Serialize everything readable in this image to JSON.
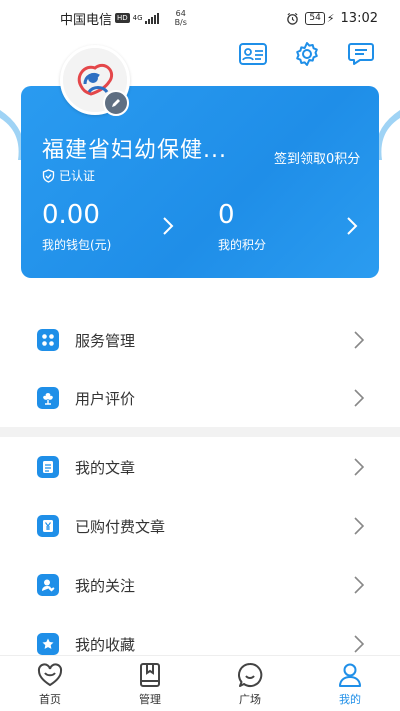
{
  "status_bar": {
    "carrier": "中国电信",
    "hd": "HD",
    "network": "4G",
    "speed_value": "64",
    "speed_unit": "B/s",
    "battery": "54",
    "time": "13:02"
  },
  "top_icons": [
    "contact-card-icon",
    "gear-icon",
    "message-icon"
  ],
  "profile": {
    "org_name": "福建省妇幼保健...",
    "verified_label": "已认证",
    "checkin_text": "签到领取0积分",
    "wallet_value": "0.00",
    "wallet_label": "我的钱包(元)",
    "points_value": "0",
    "points_label": "我的积分"
  },
  "menu": [
    {
      "label": "服务管理",
      "icon": "grid-apps-icon"
    },
    {
      "label": "用户评价",
      "icon": "flower-badge-icon"
    },
    {
      "label": "我的文章",
      "icon": "document-icon"
    },
    {
      "label": "已购付费文章",
      "icon": "yen-document-icon"
    },
    {
      "label": "我的关注",
      "icon": "user-heart-icon"
    },
    {
      "label": "我的收藏",
      "icon": "star-folder-icon"
    }
  ],
  "tabbar": {
    "items": [
      {
        "label": "首页",
        "icon": "heart-smile-icon"
      },
      {
        "label": "管理",
        "icon": "bookmark-book-icon"
      },
      {
        "label": "广场",
        "icon": "chat-bubble-icon"
      },
      {
        "label": "我的",
        "icon": "person-icon"
      }
    ],
    "active_index": 3
  },
  "colors": {
    "accent": "#1f8fe8",
    "card": "#2a9bf0",
    "divider": "#f2f2f2"
  }
}
